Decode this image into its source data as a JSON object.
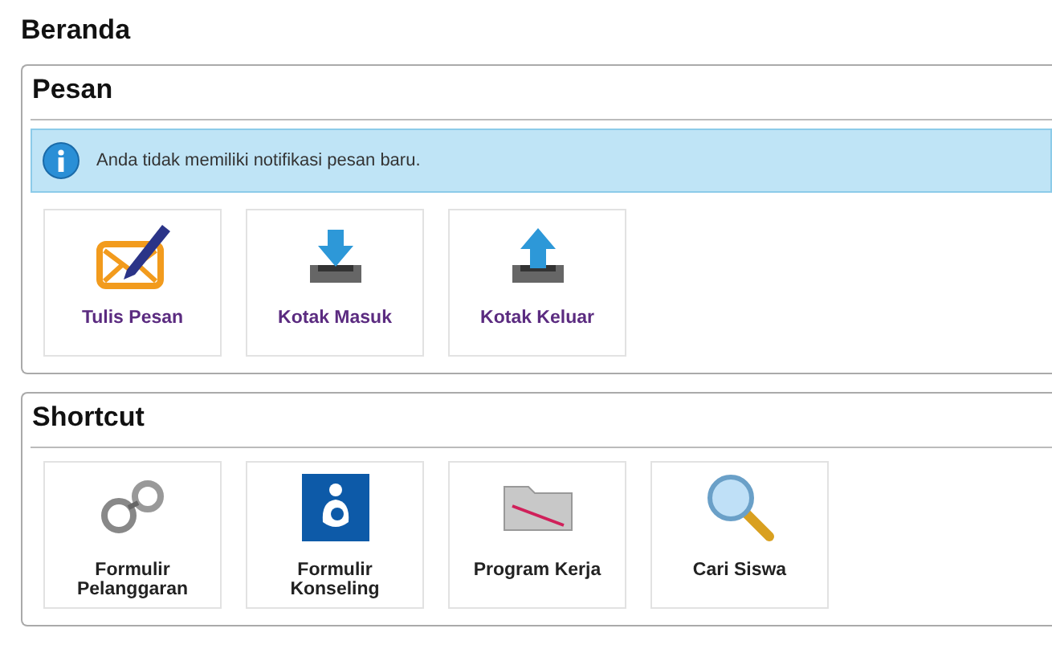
{
  "page_title": "Beranda",
  "sections": [
    {
      "title": "Pesan",
      "kind": "messages",
      "notice": "Anda tidak memiliki notifikasi pesan baru.",
      "tiles": [
        {
          "label": "Tulis Pesan",
          "kind": "compose"
        },
        {
          "label": "Kotak Masuk",
          "kind": "inbox"
        },
        {
          "label": "Kotak Keluar",
          "kind": "outbox"
        }
      ]
    },
    {
      "title": "Shortcut",
      "kind": "shortcuts",
      "tiles": [
        {
          "label": "Formulir Pelanggaran",
          "kind": "handcuffs"
        },
        {
          "label": "Formulir Konseling",
          "kind": "counseling"
        },
        {
          "label": "Program Kerja",
          "kind": "folder"
        },
        {
          "label": "Cari Siswa",
          "kind": "search"
        }
      ]
    }
  ]
}
